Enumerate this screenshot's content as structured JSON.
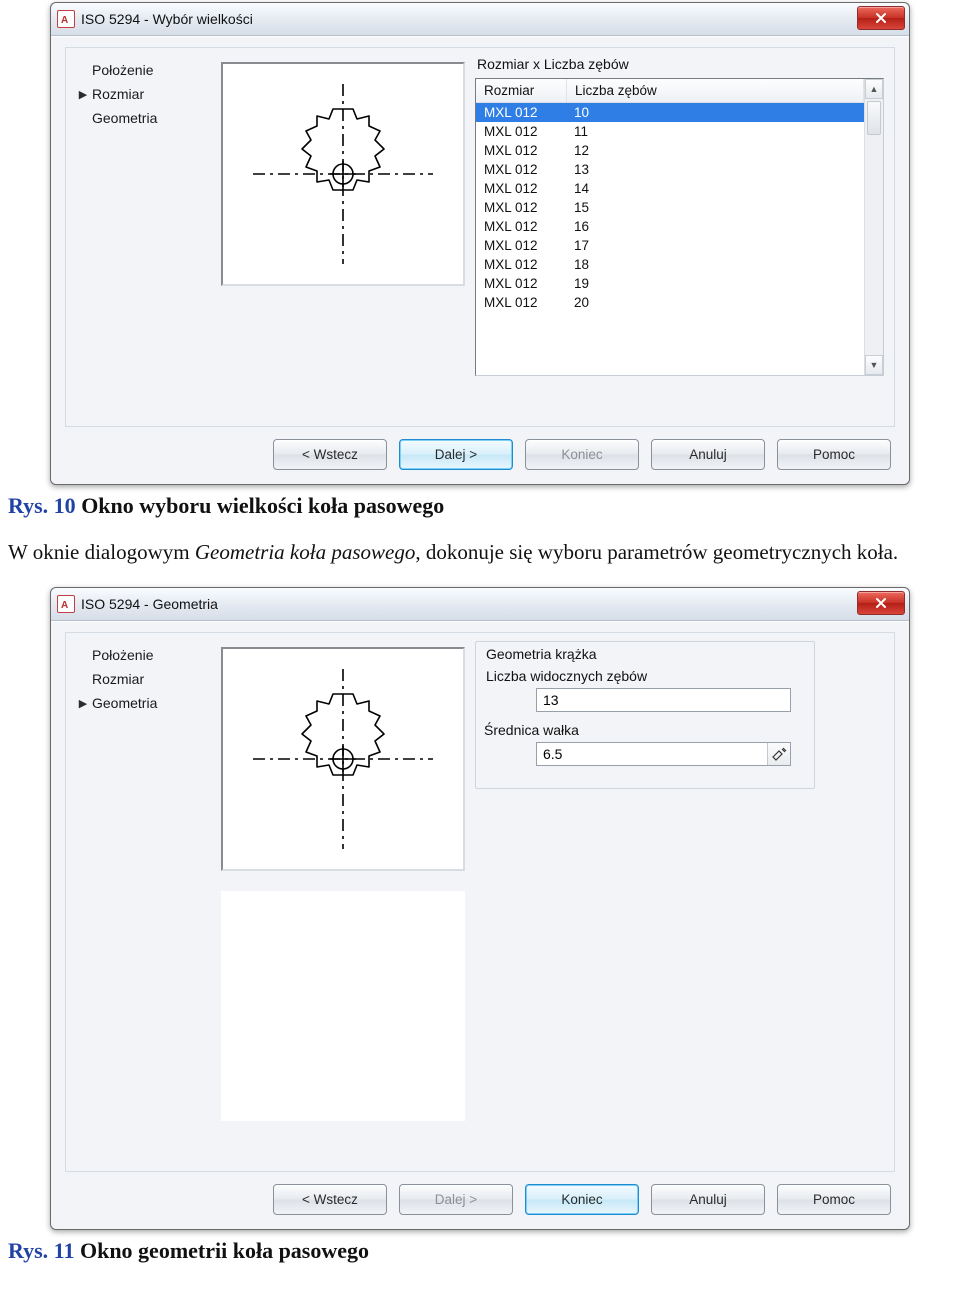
{
  "captions": {
    "fig10_prefix": "Rys. 10 ",
    "fig10_text": "Okno wyboru wielkości koła pasowego",
    "fig11_prefix": "Rys. 11 ",
    "fig11_text": "Okno geometrii koła pasowego"
  },
  "paragraph": {
    "p1a": "W   oknie   dialogowym   ",
    "p1_italic": "Geometria   koła   pasowego",
    "p1b": ",   dokonuje   się   wyboru   parametrów geometrycznych koła."
  },
  "dialog1": {
    "title": "ISO 5294 - Wybór wielkości",
    "nav": {
      "item0": "Położenie",
      "item1": "Rozmiar",
      "item2": "Geometria"
    },
    "active_nav_index": 1,
    "list_title": "Rozmiar x Liczba zębów",
    "columns": {
      "a": "Rozmiar",
      "b": "Liczba zębów"
    },
    "rows": [
      {
        "a": "MXL 012",
        "b": "10"
      },
      {
        "a": "MXL 012",
        "b": "11"
      },
      {
        "a": "MXL 012",
        "b": "12"
      },
      {
        "a": "MXL 012",
        "b": "13"
      },
      {
        "a": "MXL 012",
        "b": "14"
      },
      {
        "a": "MXL 012",
        "b": "15"
      },
      {
        "a": "MXL 012",
        "b": "16"
      },
      {
        "a": "MXL 012",
        "b": "17"
      },
      {
        "a": "MXL 012",
        "b": "18"
      },
      {
        "a": "MXL 012",
        "b": "19"
      },
      {
        "a": "MXL 012",
        "b": "20"
      }
    ],
    "selected_row": 0,
    "buttons": {
      "back": "< Wstecz",
      "next": "Dalej >",
      "finish": "Koniec",
      "cancel": "Anuluj",
      "help": "Pomoc"
    }
  },
  "dialog2": {
    "title": "ISO 5294 - Geometria",
    "nav": {
      "item0": "Położenie",
      "item1": "Rozmiar",
      "item2": "Geometria"
    },
    "active_nav_index": 2,
    "fieldset_title": "Geometria krążka",
    "field1_label": "Liczba widocznych zębów",
    "field1_value": "13",
    "field2_label": "Średnica wałka",
    "field2_value": "6.5",
    "buttons": {
      "back": "< Wstecz",
      "next": "Dalej >",
      "finish": "Koniec",
      "cancel": "Anuluj",
      "help": "Pomoc"
    }
  }
}
